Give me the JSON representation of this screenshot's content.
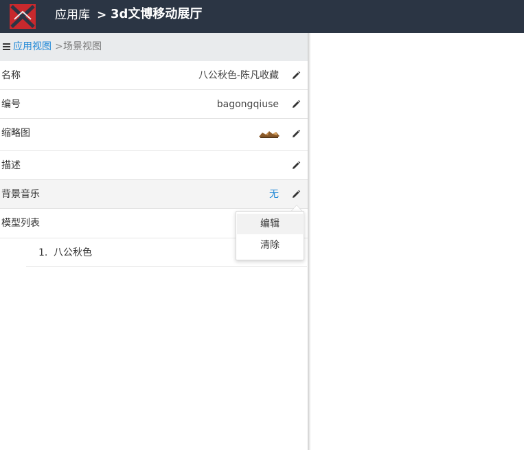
{
  "header": {
    "app_crumb": "应用库",
    "separator": ">",
    "current": "3d文博移动展厅",
    "logo_icon": "app-logo-x",
    "bg_color": "#2b3544"
  },
  "subheader": {
    "menu_icon": "hamburger-menu-icon",
    "link": "应用视图",
    "separator": ">",
    "current": "场景视图"
  },
  "properties": [
    {
      "label": "名称",
      "value": "八公秋色-陈凡收藏"
    },
    {
      "label": "编号",
      "value": "bagongqiuse"
    },
    {
      "label": "缩略图",
      "value": ""
    },
    {
      "label": "描述",
      "value": ""
    },
    {
      "label": "背景音乐",
      "value": "无"
    }
  ],
  "model_list": {
    "label": "模型列表",
    "items": [
      {
        "num": "1.",
        "name": "八公秋色"
      }
    ]
  },
  "popover": {
    "items": [
      "编辑",
      "清除"
    ]
  },
  "colors": {
    "link": "#1e87d6",
    "topbar": "#2b3544",
    "logo_red": "#c8292d"
  }
}
